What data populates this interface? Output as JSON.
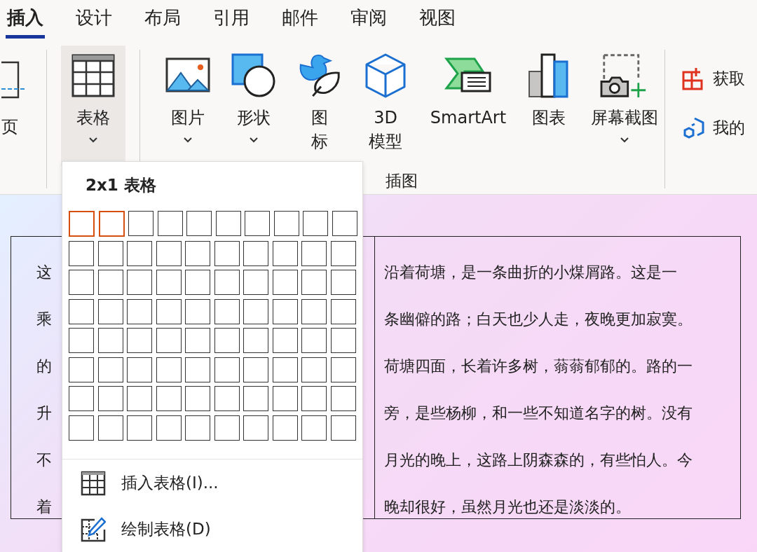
{
  "tabs": [
    {
      "label": "插入",
      "selected": true
    },
    {
      "label": "设计",
      "selected": false
    },
    {
      "label": "布局",
      "selected": false
    },
    {
      "label": "引用",
      "selected": false
    },
    {
      "label": "邮件",
      "selected": false
    },
    {
      "label": "审阅",
      "selected": false
    },
    {
      "label": "视图",
      "selected": false
    }
  ],
  "ribbon": {
    "left_partial": {
      "label": "页"
    },
    "table_button": {
      "label": "表格",
      "selected": true,
      "dropdown": true
    },
    "illustrations": {
      "group_label": "插图",
      "buttons": [
        {
          "lines": [
            "图片"
          ],
          "dropdown": true
        },
        {
          "lines": [
            "形状"
          ],
          "dropdown": true
        },
        {
          "lines": [
            "图",
            "标"
          ],
          "dropdown": false
        },
        {
          "lines": [
            "3D",
            "模型"
          ],
          "dropdown": false
        },
        {
          "lines": [
            "SmartArt"
          ],
          "dropdown": false
        },
        {
          "lines": [
            "图表"
          ],
          "dropdown": false
        },
        {
          "lines": [
            "屏幕截图"
          ],
          "dropdown": true
        }
      ]
    },
    "addins": [
      {
        "label": "获取"
      },
      {
        "label": "我的"
      }
    ]
  },
  "table_menu": {
    "title": "2x1 表格",
    "grid": [
      {
        "cells": [
          {
            "selected": true
          },
          {
            "selected": true
          },
          {
            "selected": false
          },
          {
            "selected": false
          },
          {
            "selected": false
          },
          {
            "selected": false
          },
          {
            "selected": false
          },
          {
            "selected": false
          },
          {
            "selected": false
          },
          {
            "selected": false
          }
        ]
      },
      {
        "cells": [
          {
            "selected": false
          },
          {
            "selected": false
          },
          {
            "selected": false
          },
          {
            "selected": false
          },
          {
            "selected": false
          },
          {
            "selected": false
          },
          {
            "selected": false
          },
          {
            "selected": false
          },
          {
            "selected": false
          },
          {
            "selected": false
          }
        ]
      },
      {
        "cells": [
          {
            "selected": false
          },
          {
            "selected": false
          },
          {
            "selected": false
          },
          {
            "selected": false
          },
          {
            "selected": false
          },
          {
            "selected": false
          },
          {
            "selected": false
          },
          {
            "selected": false
          },
          {
            "selected": false
          },
          {
            "selected": false
          }
        ]
      },
      {
        "cells": [
          {
            "selected": false
          },
          {
            "selected": false
          },
          {
            "selected": false
          },
          {
            "selected": false
          },
          {
            "selected": false
          },
          {
            "selected": false
          },
          {
            "selected": false
          },
          {
            "selected": false
          },
          {
            "selected": false
          },
          {
            "selected": false
          }
        ]
      },
      {
        "cells": [
          {
            "selected": false
          },
          {
            "selected": false
          },
          {
            "selected": false
          },
          {
            "selected": false
          },
          {
            "selected": false
          },
          {
            "selected": false
          },
          {
            "selected": false
          },
          {
            "selected": false
          },
          {
            "selected": false
          },
          {
            "selected": false
          }
        ]
      },
      {
        "cells": [
          {
            "selected": false
          },
          {
            "selected": false
          },
          {
            "selected": false
          },
          {
            "selected": false
          },
          {
            "selected": false
          },
          {
            "selected": false
          },
          {
            "selected": false
          },
          {
            "selected": false
          },
          {
            "selected": false
          },
          {
            "selected": false
          }
        ]
      },
      {
        "cells": [
          {
            "selected": false
          },
          {
            "selected": false
          },
          {
            "selected": false
          },
          {
            "selected": false
          },
          {
            "selected": false
          },
          {
            "selected": false
          },
          {
            "selected": false
          },
          {
            "selected": false
          },
          {
            "selected": false
          },
          {
            "selected": false
          }
        ]
      },
      {
        "cells": [
          {
            "selected": false
          },
          {
            "selected": false
          },
          {
            "selected": false
          },
          {
            "selected": false
          },
          {
            "selected": false
          },
          {
            "selected": false
          },
          {
            "selected": false
          },
          {
            "selected": false
          },
          {
            "selected": false
          },
          {
            "selected": false
          }
        ]
      }
    ],
    "items": [
      {
        "label": "插入表格(I)..."
      },
      {
        "label": "绘制表格(D)"
      }
    ]
  },
  "document": {
    "table": {
      "left_cell": [
        "这",
        "乘",
        "的",
        "升",
        "不",
        "着"
      ],
      "right_cell": [
        "沿着荷塘，是一条曲折的小煤屑路。这是一",
        "条幽僻的路；白天也少人走，夜晚更加寂寞。",
        "荷塘四面，长着许多树，蓊蓊郁郁的。路的一",
        "旁，是些杨柳，和一些不知道名字的树。没有",
        "月光的晚上，这路上阴森森的，有些怕人。今",
        "晚却很好，虽然月光也还是淡淡的。"
      ]
    }
  }
}
